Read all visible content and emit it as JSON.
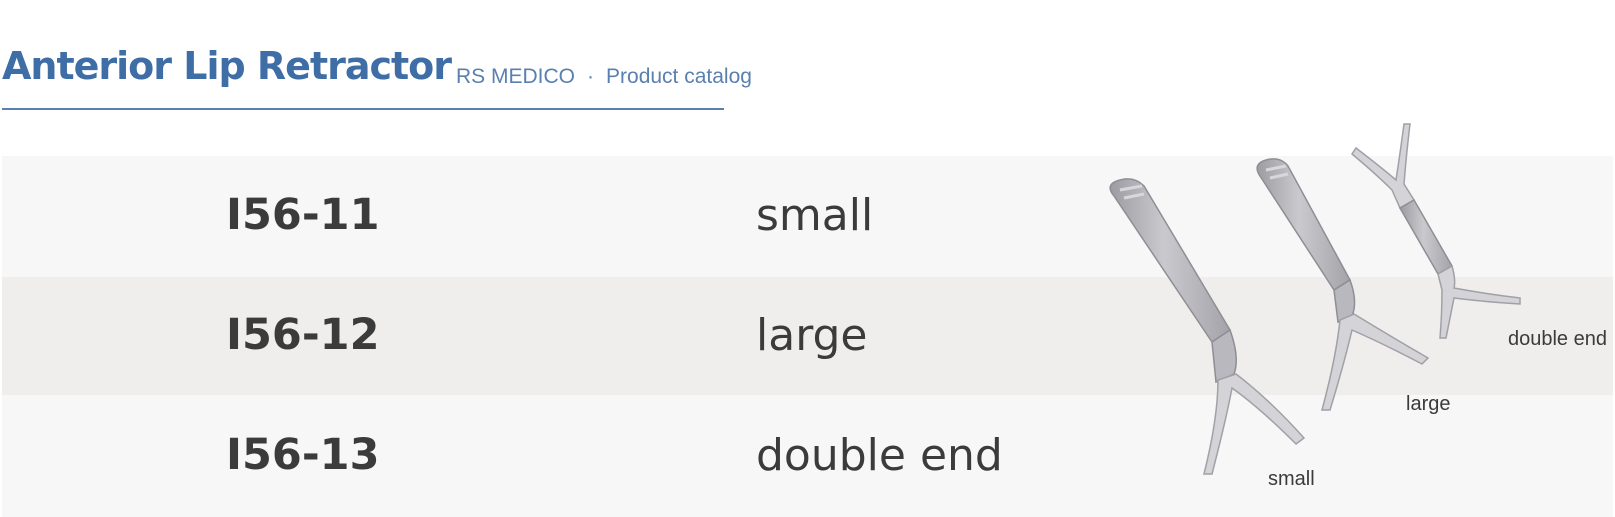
{
  "header": {
    "title": "Anterior Lip Retractor",
    "brand": "RS MEDICO",
    "separator": "·",
    "section": "Product catalog",
    "accent_color": "#3f6da6"
  },
  "table": {
    "rows": [
      {
        "code": "I56-11",
        "description": "small"
      },
      {
        "code": "I56-12",
        "description": "large"
      },
      {
        "code": "I56-13",
        "description": "double end"
      }
    ]
  },
  "product_image": {
    "labels": {
      "small": "small",
      "large": "large",
      "double_end": "double end"
    }
  }
}
